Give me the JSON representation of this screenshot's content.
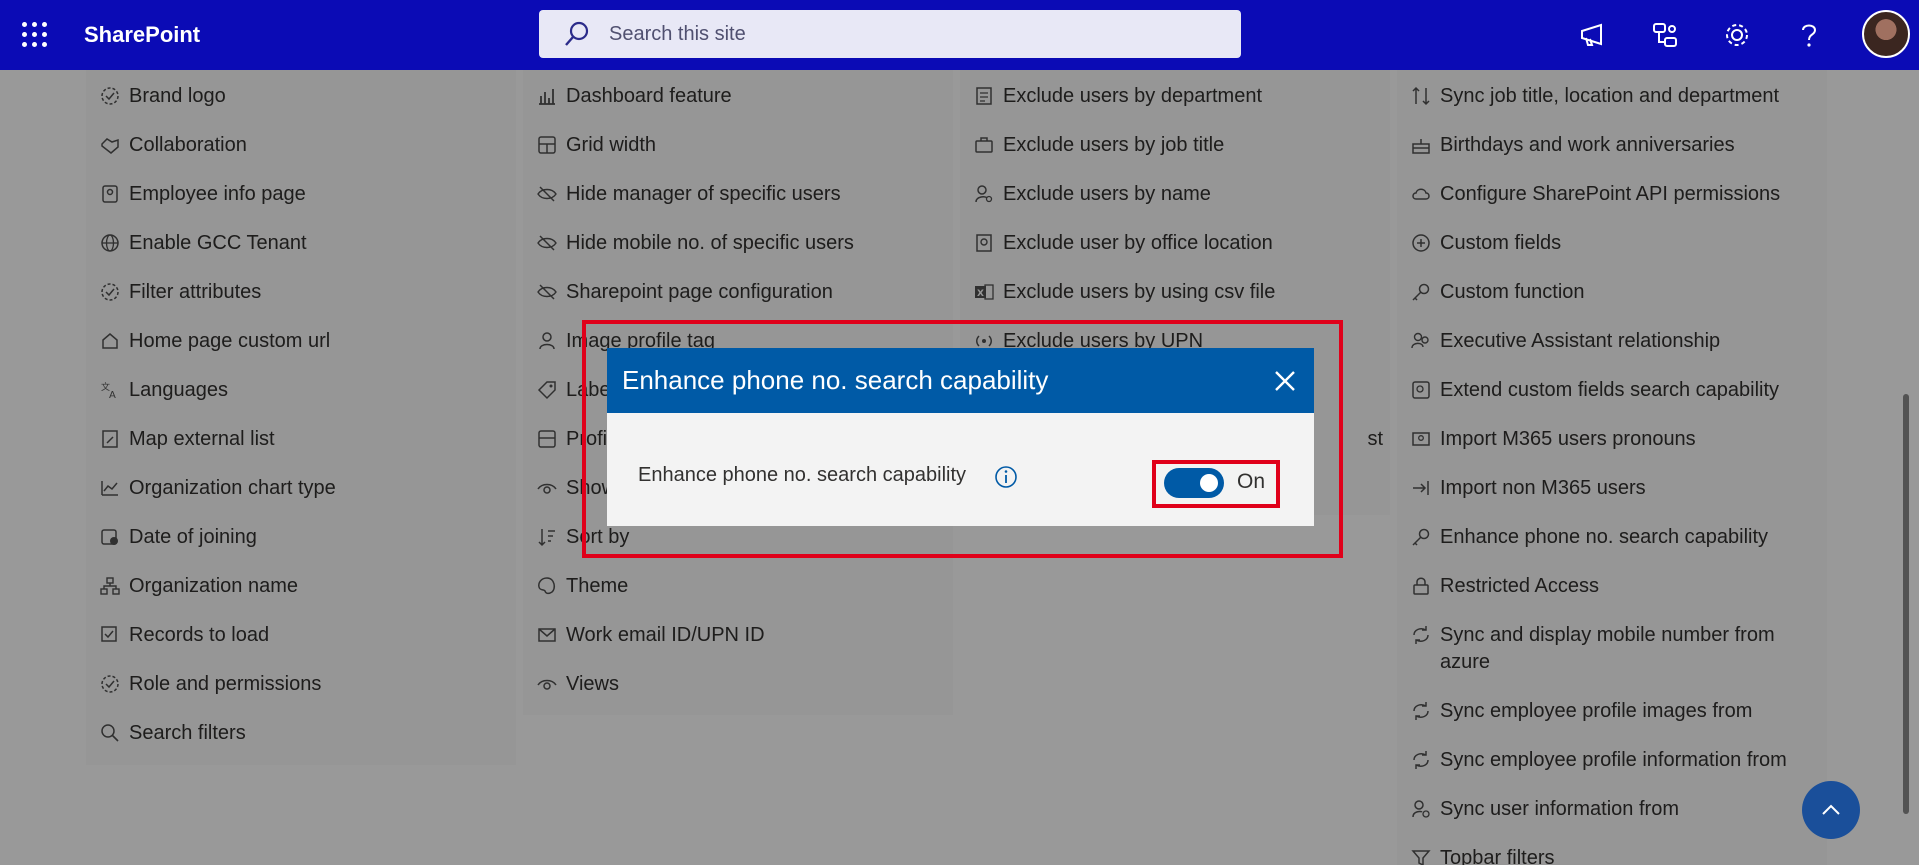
{
  "app": {
    "brand": "SharePoint"
  },
  "search": {
    "placeholder": "Search this site"
  },
  "topbar": {
    "icons": [
      "megaphone-icon",
      "connections-icon",
      "gear-icon",
      "help-icon"
    ]
  },
  "columns": {
    "col1": [
      "Brand logo",
      "Collaboration",
      "Employee info page",
      "Enable GCC Tenant",
      "Filter attributes",
      "Home page custom url",
      "Languages",
      "Map external list",
      "Organization chart type",
      "Date of joining",
      "Organization name",
      "Records to load",
      "Role and permissions",
      "Search filters"
    ],
    "col2": [
      "Dashboard feature",
      "Grid width",
      "Hide manager of specific users",
      "Hide mobile no. of specific users",
      "Sharepoint page configuration",
      "Image profile tag",
      "Labe",
      "Profi",
      "Show",
      "Sort by",
      "Theme",
      "Work email ID/UPN ID",
      "Views"
    ],
    "col3": [
      "Exclude users by department",
      "Exclude users by job title",
      "Exclude users by name",
      "Exclude user by office location",
      "Exclude users by using csv file",
      "Exclude users by UPN",
      "",
      "st"
    ],
    "col4": [
      "Sync job title, location and department",
      "Birthdays and work anniversaries",
      "Configure SharePoint API permissions",
      "Custom fields",
      "Custom function",
      "Executive Assistant relationship",
      "Extend custom fields search capability",
      "Import M365 users pronouns",
      "Import non M365 users",
      "Enhance phone no. search capability",
      "Restricted Access",
      "Sync and display mobile number from azure",
      "Sync employee profile images from",
      "Sync employee profile information from",
      "Sync user information from",
      "Topbar filters"
    ]
  },
  "dialog": {
    "title": "Enhance phone no. search capability",
    "setting_label": "Enhance phone no. search capability",
    "toggle_state": "On",
    "toggle_on": true
  },
  "colors": {
    "topbar": "#0b0bb5",
    "dialog_header": "#005aa6",
    "highlight": "#e0001a"
  }
}
